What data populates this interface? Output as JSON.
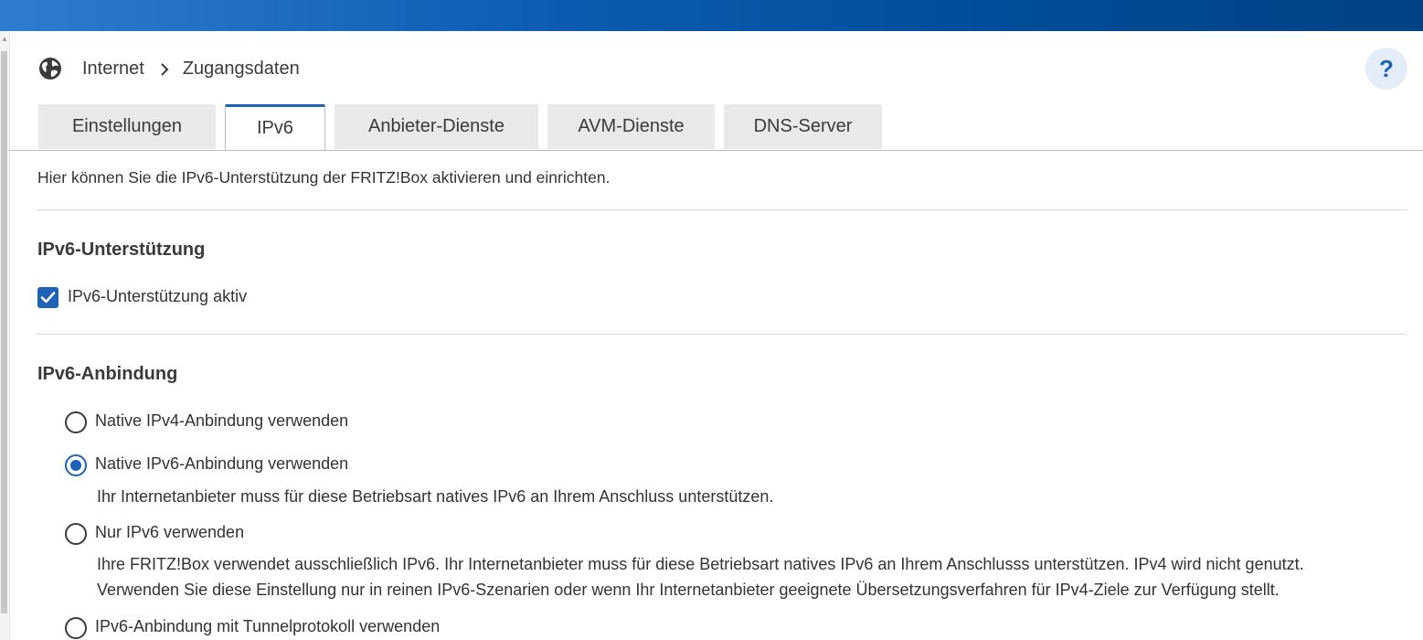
{
  "breadcrumb": {
    "section": "Internet",
    "page": "Zugangsdaten"
  },
  "help": {
    "label": "?"
  },
  "tabs": [
    {
      "label": "Einstellungen",
      "active": false
    },
    {
      "label": "IPv6",
      "active": true
    },
    {
      "label": "Anbieter-Dienste",
      "active": false
    },
    {
      "label": "AVM-Dienste",
      "active": false
    },
    {
      "label": "DNS-Server",
      "active": false
    }
  ],
  "intro": "Hier können Sie die IPv6-Unterstützung der FRITZ!Box aktivieren und einrichten.",
  "support": {
    "title": "IPv6-Unterstützung",
    "checkbox_label": "IPv6-Unterstützung aktiv",
    "checked": true
  },
  "connection": {
    "title": "IPv6-Anbindung",
    "options": [
      {
        "label": "Native IPv4-Anbindung verwenden",
        "checked": false,
        "desc": []
      },
      {
        "label": "Native IPv6-Anbindung verwenden",
        "checked": true,
        "desc": [
          "Ihr Internetanbieter muss für diese Betriebsart natives IPv6 an Ihrem Anschluss unterstützen."
        ]
      },
      {
        "label": "Nur IPv6 verwenden",
        "checked": false,
        "desc": [
          "Ihre FRITZ!Box verwendet ausschließlich IPv6. Ihr Internetanbieter muss für diese Betriebsart natives IPv6 an Ihrem Anschlusss unterstützen. IPv4 wird nicht genutzt.",
          "Verwenden Sie diese Einstellung nur in reinen IPv6-Szenarien oder wenn Ihr Internetanbieter geeignete Übersetzungsverfahren für IPv4-Ziele zur Verfügung stellt."
        ]
      },
      {
        "label": "IPv6-Anbindung mit Tunnelprotokoll verwenden",
        "checked": false,
        "desc": []
      }
    ]
  },
  "colors": {
    "accent": "#1d62b5",
    "topbar": "#004a94"
  }
}
